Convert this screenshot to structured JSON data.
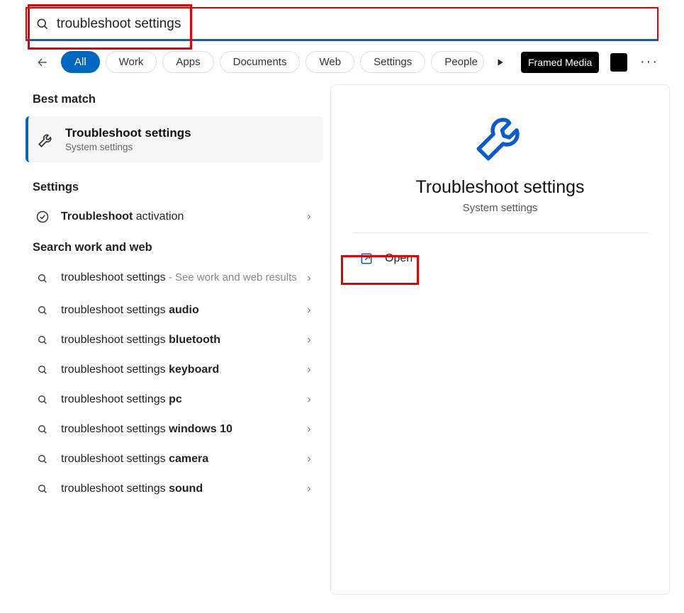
{
  "search": {
    "value": "troubleshoot settings"
  },
  "tabs": {
    "all": "All",
    "work": "Work",
    "apps": "Apps",
    "documents": "Documents",
    "web": "Web",
    "settings": "Settings",
    "people": "People",
    "framed_media": "Framed Media"
  },
  "sections": {
    "best_match": "Best match",
    "settings": "Settings",
    "search_web": "Search work and web"
  },
  "best_match_item": {
    "title": "Troubleshoot settings",
    "subtitle": "System settings"
  },
  "settings_items": [
    {
      "prefix": "Troubleshoot",
      "suffix": " activation"
    }
  ],
  "web_results": [
    {
      "text": "troubleshoot settings",
      "hint": " - See work and web results",
      "sub": ""
    },
    {
      "text": "troubleshoot settings ",
      "bold": "audio"
    },
    {
      "text": "troubleshoot settings ",
      "bold": "bluetooth"
    },
    {
      "text": "troubleshoot settings ",
      "bold": "keyboard"
    },
    {
      "text": "troubleshoot settings ",
      "bold": "pc"
    },
    {
      "text": "troubleshoot settings ",
      "bold": "windows 10"
    },
    {
      "text": "troubleshoot settings ",
      "bold": "camera"
    },
    {
      "text": "troubleshoot settings ",
      "bold": "sound"
    }
  ],
  "detail": {
    "title": "Troubleshoot settings",
    "subtitle": "System settings",
    "open_label": "Open"
  }
}
